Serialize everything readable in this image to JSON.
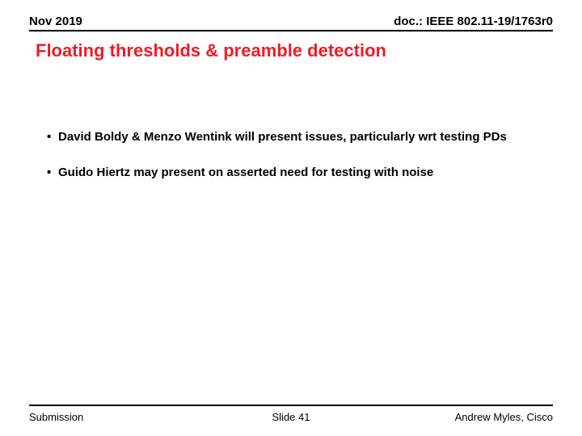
{
  "header": {
    "date": "Nov 2019",
    "doc": "doc.: IEEE 802.11-19/1763r0"
  },
  "title": "Floating thresholds & preamble detection",
  "bullets": [
    "David Boldy & Menzo Wentink will present issues, particularly wrt testing PDs",
    "Guido Hiertz may present on asserted need for testing with noise"
  ],
  "footer": {
    "left": "Submission",
    "center": "Slide 41",
    "right": "Andrew Myles, Cisco"
  }
}
